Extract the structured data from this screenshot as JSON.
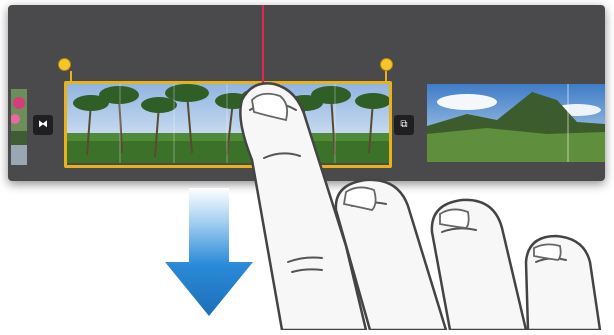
{
  "timeline": {
    "accent_color": "#e9b21d",
    "playhead_color": "#e2264f",
    "clips": [
      {
        "name": "flower-clip",
        "icon": "flower-thumbnail"
      },
      {
        "name": "palm-trees-clip",
        "selected": true,
        "icon": "palm-trees-thumbnail"
      },
      {
        "name": "mountain-clip",
        "icon": "mountain-thumbnail"
      }
    ],
    "transitions": [
      {
        "icon": "cross-dissolve-icon",
        "glyph": "⧓"
      },
      {
        "icon": "slide-transition-icon",
        "glyph": "⧉"
      }
    ]
  },
  "gesture": {
    "type": "swipe-down",
    "arrow_color": "#1c7fd0",
    "hand_icon": "hand-pointer-icon"
  }
}
